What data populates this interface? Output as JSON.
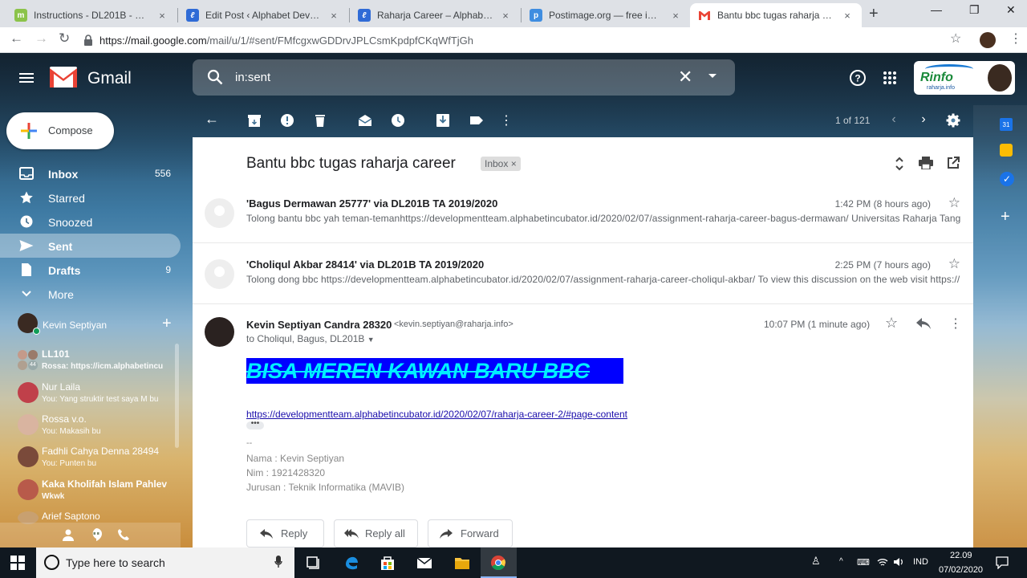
{
  "browser": {
    "tabs": [
      {
        "title": "Instructions - DL201B - Sistem In",
        "favicon": "moodle-icon"
      },
      {
        "title": "Edit Post ‹ Alphabet Developme",
        "favicon": "wordpress-icon"
      },
      {
        "title": "Raharja Career – Alphabet Devel",
        "favicon": "wordpress-icon"
      },
      {
        "title": "Postimage.org — free image ho",
        "favicon": "postimage-icon"
      },
      {
        "title": "Bantu bbc tugas raharja career",
        "favicon": "gmail-icon"
      }
    ],
    "close_glyph": "×",
    "new_tab_glyph": "+",
    "url_host": "https://mail.google.com",
    "url_path": "/mail/u/1/#sent/FMfcgxwGDDrvJPLCsmKpdpfCKqWfTjGh"
  },
  "gmail": {
    "product_name": "Gmail",
    "search_query": "in:sent",
    "brand_badge": {
      "text": "Rinfo",
      "subtext": "raharja.info"
    },
    "compose_label": "Compose",
    "nav": [
      {
        "label": "Inbox",
        "count": "556",
        "icon": "inbox-icon"
      },
      {
        "label": "Starred",
        "count": "",
        "icon": "star-icon"
      },
      {
        "label": "Snoozed",
        "count": "",
        "icon": "clock-icon"
      },
      {
        "label": "Sent",
        "count": "",
        "icon": "send-icon"
      },
      {
        "label": "Drafts",
        "count": "9",
        "icon": "draft-icon"
      },
      {
        "label": "More",
        "count": "",
        "icon": "chevron-down-icon"
      }
    ],
    "hangouts": {
      "me": "Kevin Septiyan",
      "add_glyph": "+",
      "contacts": [
        {
          "name": "LL101",
          "message": "Rossa: https://icm.alphabetincu",
          "badge": "44",
          "bold": true
        },
        {
          "name": "Nur Laila",
          "message": "You: Yang struktir test saya M bu",
          "bold": false
        },
        {
          "name": "Rossa v.o.",
          "message": "You: Makasih bu",
          "bold": false
        },
        {
          "name": "Fadhli Cahya Denna 28494",
          "message": "You: Punten bu",
          "bold": false
        },
        {
          "name": "Kaka Kholifah Islam Pahlev",
          "message": "Wkwk",
          "bold": true
        },
        {
          "name": "Arief Saptono",
          "message": "",
          "bold": false
        }
      ]
    },
    "pager": "1 of 121",
    "thread": {
      "subject": "Bantu bbc tugas raharja career",
      "label_chip": "Inbox",
      "label_chip_close": "×",
      "messages": [
        {
          "from": "'Bagus Dermawan 25777' via DL201B TA 2019/2020",
          "time": "1:42 PM (8 hours ago)",
          "snippet": "Tolong bantu bbc yah teman-temanhttps://developmentteam.alphabetincubator.id/2020/02/07/assignment-raharja-career-bagus-dermawan/ Universitas Raharja Tangerang ..."
        },
        {
          "from": "'Choliqul Akbar 28414' via DL201B TA 2019/2020",
          "time": "2:25 PM (7 hours ago)",
          "snippet": "Tolong dong bbc https://developmentteam.alphabetincubator.id/2020/02/07/assignment-raharja-career-choliqul-akbar/ To view this discussion on the web visit https://..."
        }
      ],
      "open_message": {
        "from_name": "Kevin Septiyan Candra 28320",
        "from_email": "<kevin.septiyan@raharja.info>",
        "time": "10:07 PM (1 minute ago)",
        "to": "to Choliqul, Bagus, DL201B",
        "big_text": "BISA MEREN KAWAN BARU BBC",
        "link": "https://developmentteam.alphabetincubator.id/2020/02/07/raharja-career-2/#page-content",
        "expand_glyph": "•••",
        "signature_sep": "--",
        "signature": [
          "Nama : Kevin Septiyan",
          "Nim : 1921428320",
          "Jurusan : Teknik Informatika (MAVIB)"
        ]
      },
      "actions": [
        {
          "label": "Reply",
          "icon": "reply-icon"
        },
        {
          "label": "Reply all",
          "icon": "reply-all-icon"
        },
        {
          "label": "Forward",
          "icon": "forward-icon"
        }
      ]
    },
    "side_apps": {
      "calendar_day": "31"
    }
  },
  "taskbar": {
    "search_placeholder": "Type here to search",
    "language": "IND",
    "time": "22.09",
    "date": "07/02/2020"
  },
  "colors": {
    "gmail_red": "#EA4335",
    "link": "#1a0dab",
    "big_text_bg": "#0000ff",
    "big_text_fg": "#00f0ff"
  }
}
